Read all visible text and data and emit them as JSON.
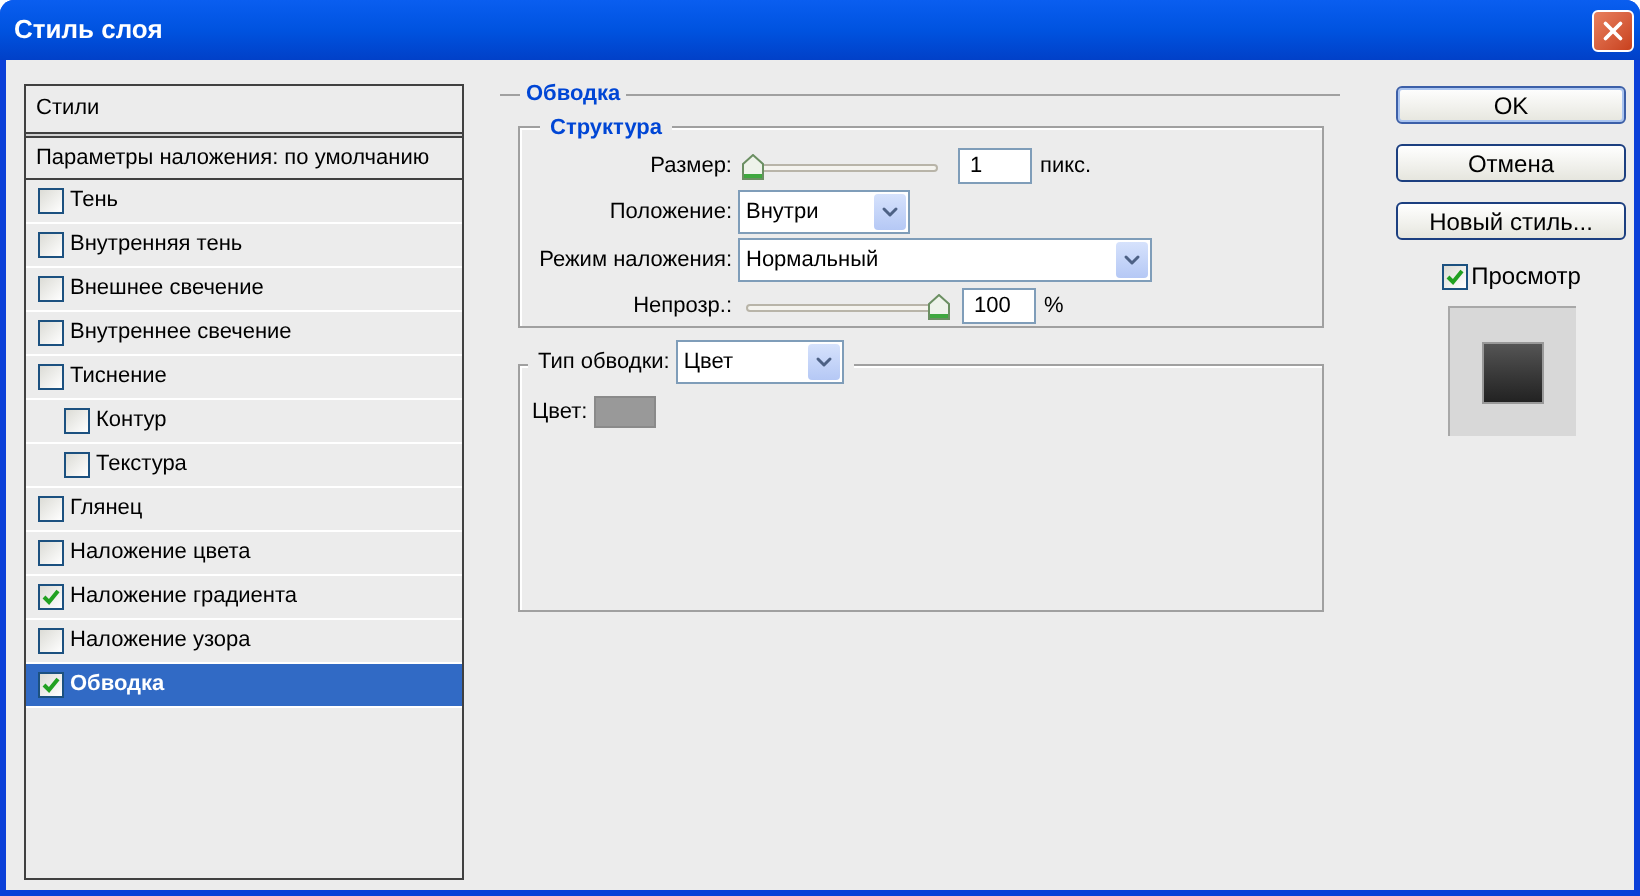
{
  "window": {
    "title": "Стиль слоя"
  },
  "styles_panel": {
    "header": "Стили",
    "blending_options": "Параметры наложения: по умолчанию",
    "items": [
      {
        "label": "Тень",
        "checked": false,
        "selected": false
      },
      {
        "label": "Внутренняя тень",
        "checked": false,
        "selected": false
      },
      {
        "label": "Внешнее свечение",
        "checked": false,
        "selected": false
      },
      {
        "label": "Внутреннее свечение",
        "checked": false,
        "selected": false
      },
      {
        "label": "Тиснение",
        "checked": false,
        "selected": false,
        "children": [
          {
            "label": "Контур",
            "checked": false,
            "selected": false
          },
          {
            "label": "Текстура",
            "checked": false,
            "selected": false
          }
        ]
      },
      {
        "label": "Глянец",
        "checked": false,
        "selected": false
      },
      {
        "label": "Наложение цвета",
        "checked": false,
        "selected": false
      },
      {
        "label": "Наложение градиента",
        "checked": true,
        "selected": false
      },
      {
        "label": "Наложение узора",
        "checked": false,
        "selected": false
      },
      {
        "label": "Обводка",
        "checked": true,
        "selected": true
      }
    ]
  },
  "stroke": {
    "title": "Обводка",
    "structure": {
      "title": "Структура",
      "size": {
        "label": "Размер:",
        "level": 0,
        "value": "1",
        "unit": "пикс."
      },
      "position": {
        "label": "Положение:",
        "value": "Внутри"
      },
      "blend_mode": {
        "label": "Режим наложения:",
        "value": "Нормальный"
      },
      "opacity": {
        "label": "Непрозр.:",
        "level": 1,
        "value": "100",
        "unit": "%"
      }
    },
    "fill": {
      "type_label": "Тип обводки:",
      "type_value": "Цвет",
      "color_label": "Цвет:",
      "color": "#999999"
    }
  },
  "buttons": [
    {
      "label": "OK"
    },
    {
      "label": "Отмена"
    },
    {
      "label": "Новый стиль..."
    }
  ],
  "preview": {
    "label": "Просмотр",
    "checked": true
  }
}
